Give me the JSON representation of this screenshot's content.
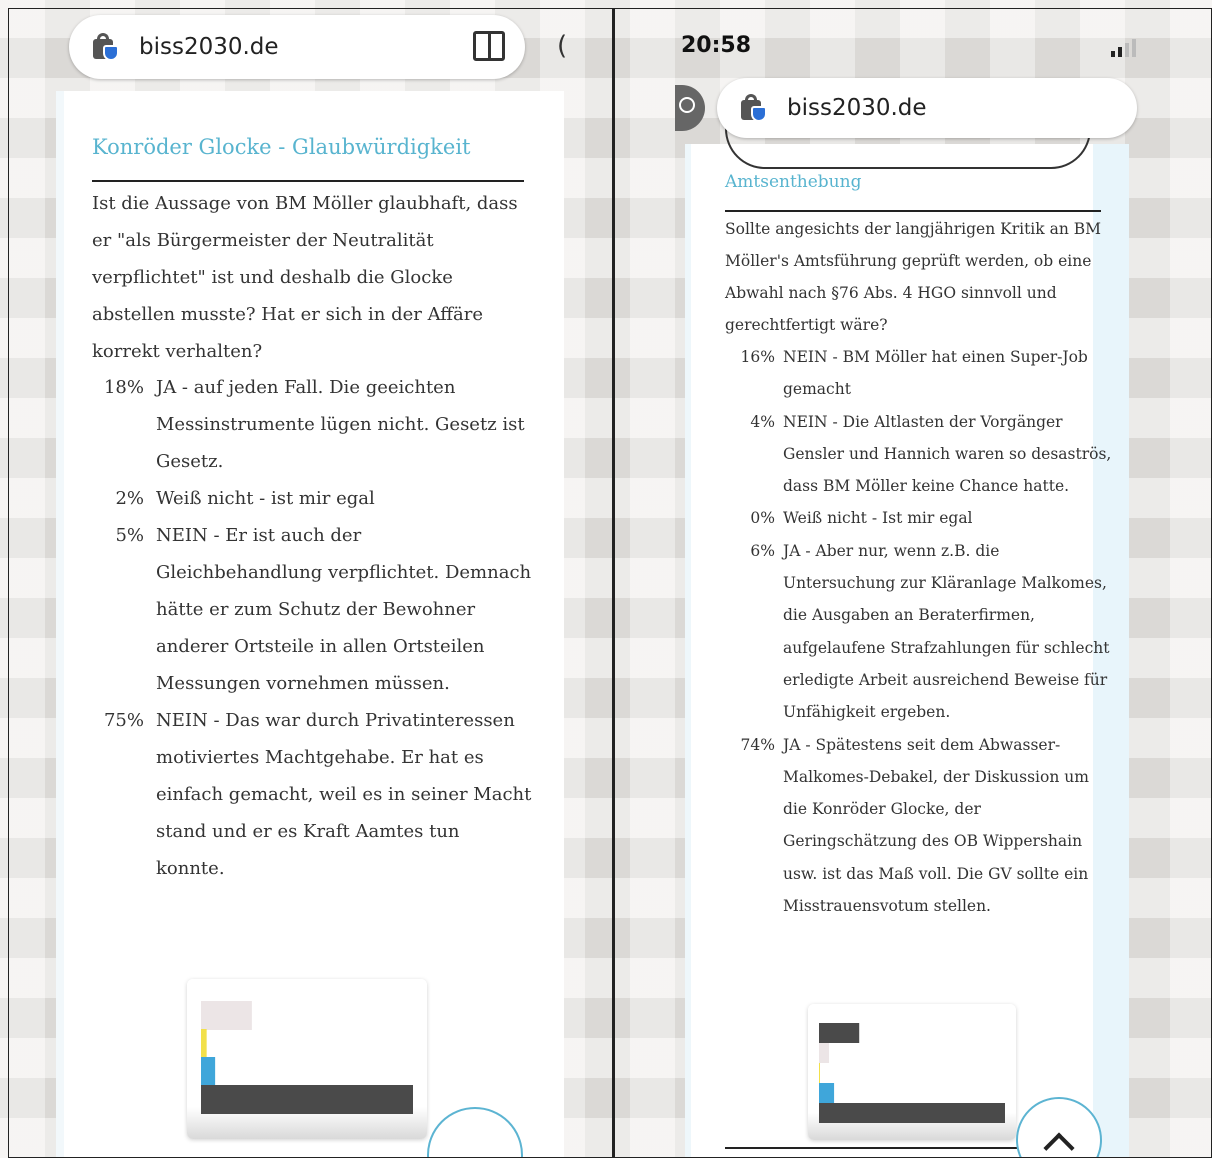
{
  "left": {
    "url": "biss2030.de",
    "title": "Konröder Glocke - Glaubwürdigkeit",
    "question": "Ist die Aussage von BM Möller glaubhaft, dass er \"als Bürgermeister der Neutralität verpflichtet\" ist und deshalb die Glocke abstellen musste? Hat er sich in der Affäre korrekt verhalten?",
    "options": [
      {
        "pct": "18%",
        "text": "JA - auf jeden Fall. Die geeichten Messinstrumente lügen nicht. Gesetz ist Gesetz."
      },
      {
        "pct": "2%",
        "text": "Weiß nicht - ist mir egal"
      },
      {
        "pct": "5%",
        "text": "NEIN - Er ist auch der Gleichbehandlung verpflichtet. Demnach hätte er zum Schutz der Bewohner anderer Ortsteile in allen Ortsteilen Messungen vornehmen müssen."
      },
      {
        "pct": "75%",
        "text": "NEIN - Das war durch Privatinteressen motiviertes Machtgehabe. Er hat es einfach gemacht, weil es in seiner Macht stand und er es Kraft Aamtes tun konnte."
      }
    ]
  },
  "right": {
    "time": "20:58",
    "url": "biss2030.de",
    "title": "Amtsenthebung",
    "question": "Sollte angesichts der langjährigen Kritik an BM Möller's Amtsführung geprüft werden, ob eine Abwahl nach §76 Abs. 4 HGO sinnvoll und gerechtfertigt wäre?",
    "options": [
      {
        "pct": "16%",
        "text": "NEIN - BM Möller hat einen Super-Job gemacht"
      },
      {
        "pct": "4%",
        "text": "NEIN - Die Altlasten der Vorgänger Gensler und Hannich waren so desaströs, dass BM Möller keine Chance hatte."
      },
      {
        "pct": "0%",
        "text": "Weiß nicht - Ist mir egal"
      },
      {
        "pct": "6%",
        "text": "JA - Aber nur, wenn z.B. die Untersuchung zur Kläranlage Malkomes, die Ausgaben an Beraterfirmen, aufgelaufene Strafzahlungen für schlecht erledigte Arbeit ausreichend Beweise für Unfähigkeit ergeben."
      },
      {
        "pct": "74%",
        "text": "JA - Spätestens seit dem Abwasser-Malkomes-Debakel, der Diskussion um die Konröder Glocke, der Geringschätzung des OB Wippershain usw. ist das Maß voll. Die GV sollte ein Misstrauensvotum stellen."
      }
    ]
  },
  "chart_data": [
    {
      "type": "bar",
      "orientation": "horizontal",
      "categories": [
        "JA - auf jeden Fall",
        "Weiß nicht",
        "NEIN - Gleichbehandlung",
        "NEIN - Privatinteressen"
      ],
      "values": [
        18,
        2,
        5,
        75
      ],
      "colors": [
        "#ece5e6",
        "#f2e04a",
        "#3fa6da",
        "#4a4a4a"
      ],
      "xlim": [
        0,
        75
      ]
    },
    {
      "type": "bar",
      "orientation": "horizontal",
      "categories": [
        "NEIN - Super-Job",
        "NEIN - Altlasten",
        "Weiß nicht",
        "JA - Aber nur, wenn",
        "JA - Spätestens"
      ],
      "values": [
        16,
        4,
        0,
        6,
        74
      ],
      "colors": [
        "#4a4a4a",
        "#ece5e6",
        "#f2e04a",
        "#3fa6da",
        "#4a4a4a"
      ],
      "xlim": [
        0,
        74
      ]
    }
  ],
  "colors": {
    "accent": "#58b4cf",
    "text": "#333333"
  }
}
